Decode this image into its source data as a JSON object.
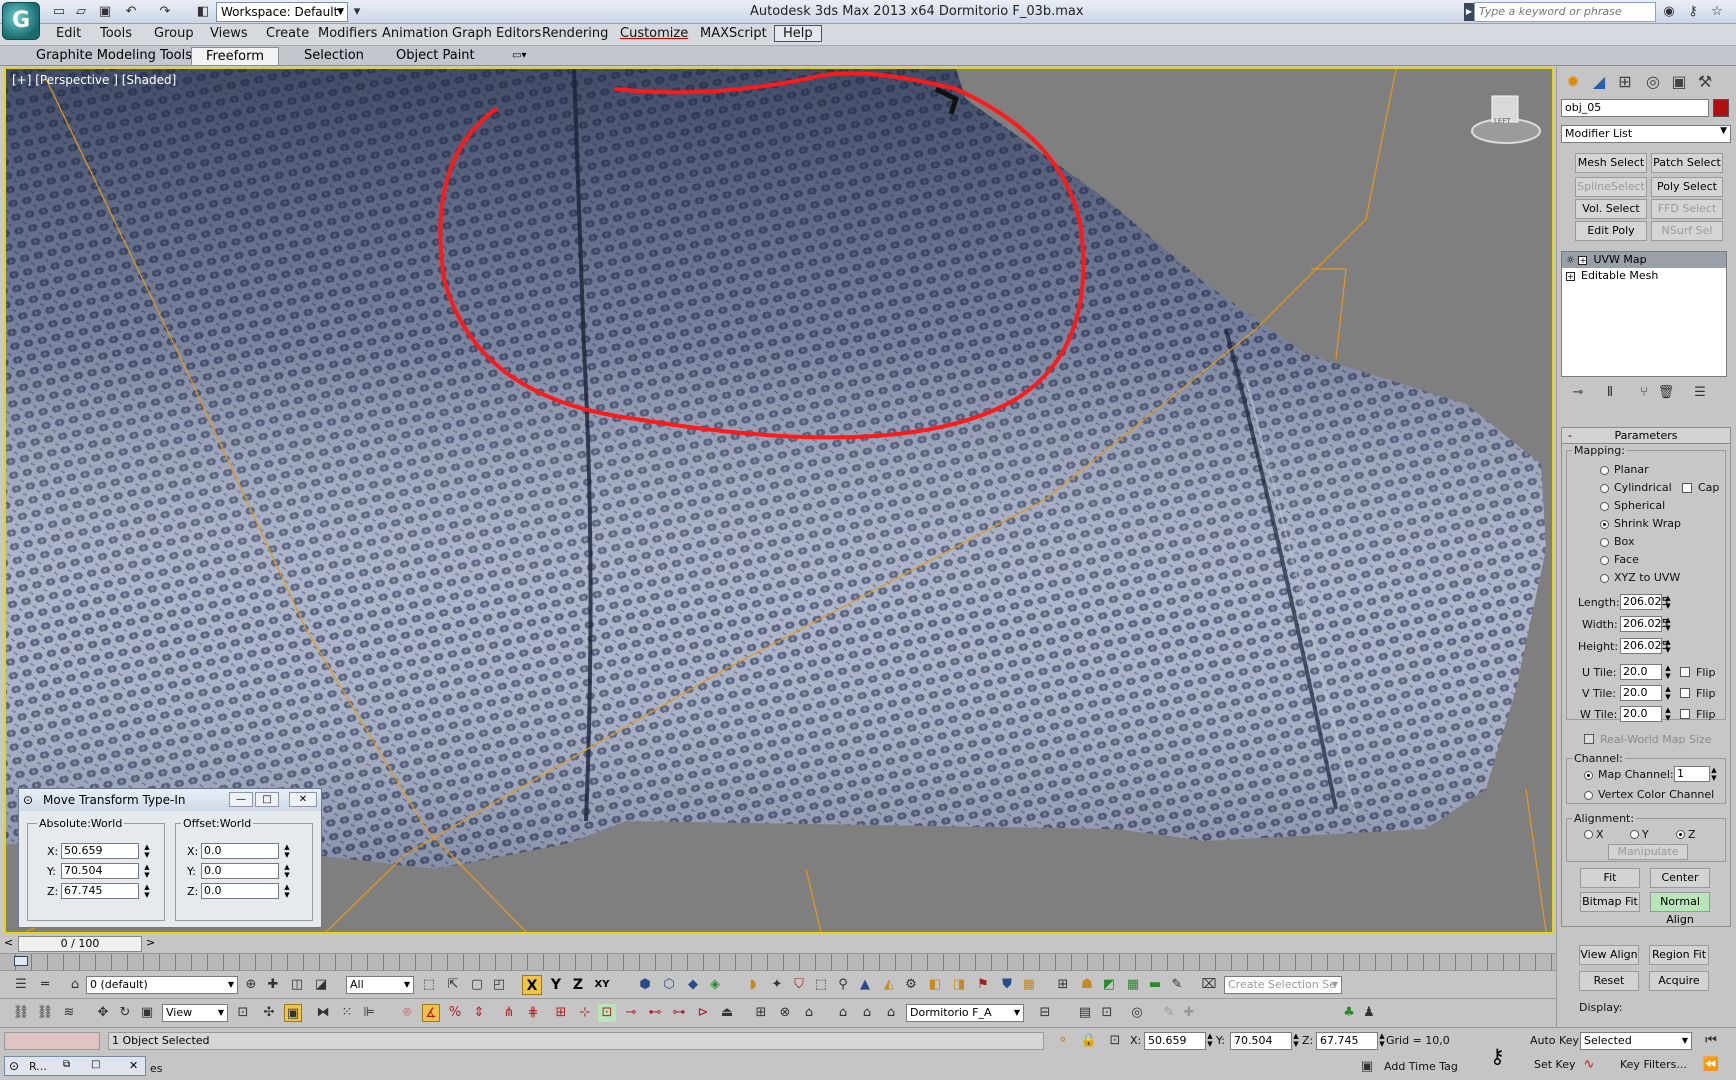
{
  "window": {
    "title": "Autodesk 3ds Max  2013 x64      Dormitorio F_03b.max",
    "workspace_label": "Workspace: Default",
    "search_placeholder": "Type a keyword or phrase"
  },
  "menu": [
    "Edit",
    "Tools",
    "Group",
    "Views",
    "Create",
    "Modifiers",
    "Animation",
    "Graph Editors",
    "Rendering",
    "Customize",
    "MAXScript",
    "Help"
  ],
  "ribbon": {
    "tabs": [
      "Graphite Modeling Tools",
      "Freeform",
      "Selection",
      "Object Paint"
    ],
    "active": "Freeform"
  },
  "viewport": {
    "label": "[+] [Perspective ] [Shaded]",
    "viewcube_face": "LEFT"
  },
  "command_panel": {
    "object_name": "obj_05",
    "object_color": "#b01010",
    "modifier_list": "Modifier List",
    "modifier_buttons": [
      {
        "label": "Mesh Select",
        "enabled": true
      },
      {
        "label": "Patch Select",
        "enabled": true
      },
      {
        "label": "SplineSelect",
        "enabled": false
      },
      {
        "label": "Poly Select",
        "enabled": true
      },
      {
        "label": "Vol. Select",
        "enabled": true
      },
      {
        "label": "FFD Select",
        "enabled": false
      },
      {
        "label": "Edit Poly",
        "enabled": true
      },
      {
        "label": "NSurf Sel",
        "enabled": false
      }
    ],
    "stack": [
      {
        "label": "UVW Map",
        "selected": true
      },
      {
        "label": "Editable Mesh",
        "selected": false
      }
    ],
    "parameters": {
      "title": "Parameters",
      "collapse": "-",
      "mapping_label": "Mapping:",
      "mapping_options": [
        "Planar",
        "Cylindrical",
        "Spherical",
        "Shrink Wrap",
        "Box",
        "Face",
        "XYZ to UVW"
      ],
      "mapping_selected": "Shrink Wrap",
      "cap_label": "Cap",
      "length_label": "Length:",
      "length": "206.025",
      "width_label": "Width:",
      "width": "206.025",
      "height_label": "Height:",
      "height": "206.025",
      "u_tile_label": "U Tile:",
      "u_tile": "20.0",
      "v_tile_label": "V Tile:",
      "v_tile": "20.0",
      "w_tile_label": "W Tile:",
      "w_tile": "20.0",
      "flip_label": "Flip",
      "real_world": "Real-World Map Size",
      "channel_label": "Channel:",
      "map_channel_label": "Map Channel:",
      "map_channel": "1",
      "vertex_color_label": "Vertex Color Channel",
      "alignment_label": "Alignment:",
      "axes": [
        "X",
        "Y",
        "Z"
      ],
      "axis_selected": "Z",
      "manipulate": "Manipulate",
      "fit": "Fit",
      "center": "Center",
      "bitmap_fit": "Bitmap Fit",
      "normal_align": "Normal Align",
      "view_align": "View Align",
      "region_fit": "Region Fit",
      "reset": "Reset",
      "acquire": "Acquire",
      "display_label": "Display:"
    }
  },
  "dialog": {
    "title": "Move Transform Type-In",
    "absolute_label": "Absolute:World",
    "offset_label": "Offset:World",
    "abs_x": "50.659",
    "abs_y": "70.504",
    "abs_z": "67.745",
    "off_x": "0.0",
    "off_y": "0.0",
    "off_z": "0.0",
    "x_label": "X:",
    "y_label": "Y:",
    "z_label": "Z:"
  },
  "timeline": {
    "frame": "0 / 100",
    "prev": "<",
    "next": ">"
  },
  "toolbar": {
    "layer": "0 (default)",
    "filter": "All",
    "axis_labels": [
      "X",
      "Y",
      "Z",
      "XY"
    ],
    "ref_coord": "View",
    "named_set": "Dormitorio F_A",
    "create_selection": "Create Selection Se"
  },
  "status": {
    "selection": "1 Object Selected",
    "x_label": "X:",
    "x": "50.659",
    "y_label": "Y:",
    "y": "70.504",
    "z_label": "Z:",
    "z": "67.745",
    "grid": "Grid = 10,0",
    "auto_key": "Auto Key",
    "selected": "Selected",
    "set_key": "Set Key",
    "key_filters": "Key Filters...",
    "add_time_tag": "Add Time Tag",
    "taskbar": "R...",
    "taskbar_tail": "es"
  }
}
